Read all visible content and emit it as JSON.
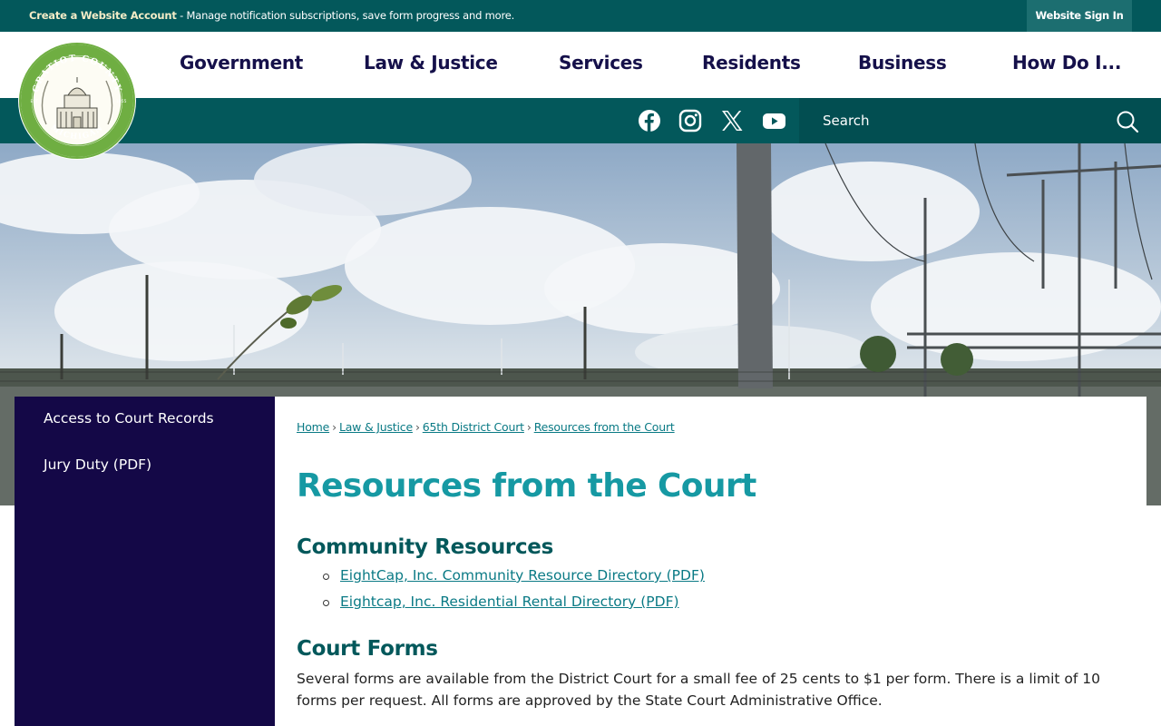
{
  "topbar": {
    "account_label": "Create a Website Account",
    "notice_text": " - Manage notification subscriptions, save form progress and more.",
    "signin_label": "Website Sign In"
  },
  "nav": {
    "items": [
      "Government",
      "Law & Justice",
      "Services",
      "Residents",
      "Business",
      "How Do I..."
    ]
  },
  "social": {
    "icons": [
      "facebook-icon",
      "instagram-icon",
      "x-icon",
      "youtube-icon"
    ]
  },
  "search": {
    "placeholder": "Search"
  },
  "logo": {
    "top_text": "GRATIOT COUNTY",
    "bottom_text": "MICHIGAN",
    "est_label": "EST",
    "year": "1855"
  },
  "sidebar": {
    "items": [
      "Access to Court Records",
      "Jury Duty (PDF)"
    ]
  },
  "breadcrumb": {
    "items": [
      "Home",
      "Law & Justice",
      "65th District Court",
      "Resources from the Court"
    ],
    "separator": "›"
  },
  "content": {
    "title": "Resources from the Court",
    "community_heading": "Community Resources",
    "community_links": [
      "EightCap, Inc. Community Resource Directory (PDF)",
      "Eightcap, Inc. Residential Rental Directory (PDF)"
    ],
    "forms_heading": "Court Forms",
    "forms_text": "Several forms are available from the District Court for a small fee of 25 cents to $1 per form. There is a limit of 10 forms per request. All forms are approved by the State Court Administrative Office."
  },
  "colors": {
    "brand_green": "#03585b",
    "nav_text": "#15104a",
    "sidebar_bg": "#140847",
    "title_teal": "#1699a3",
    "link_teal": "#0a7a85"
  }
}
